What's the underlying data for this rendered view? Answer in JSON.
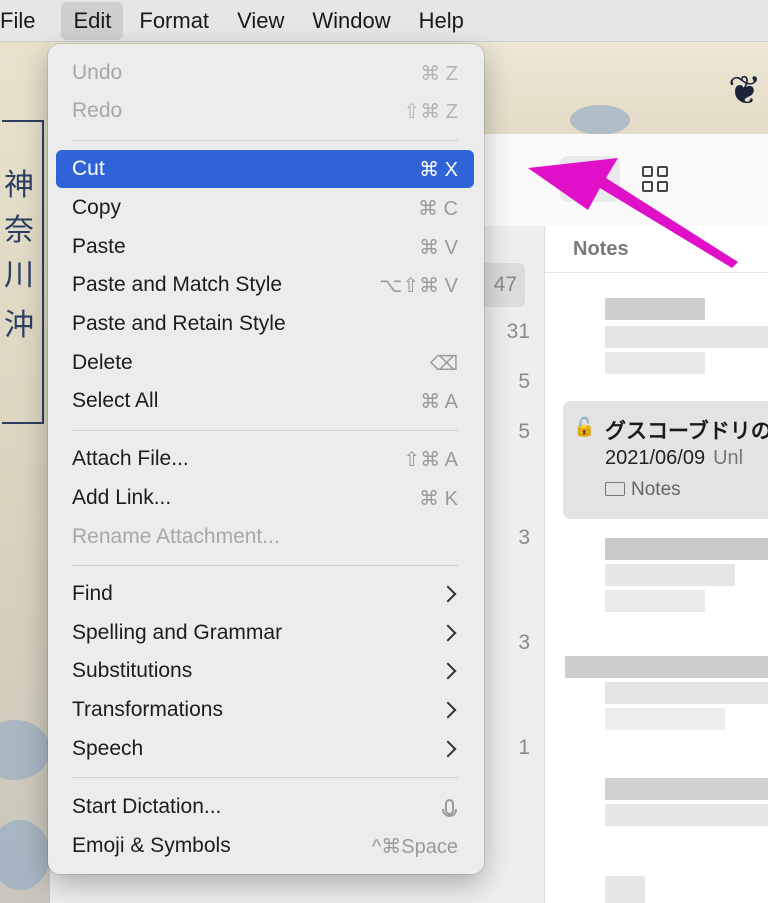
{
  "menubar": {
    "items": [
      {
        "label": "File"
      },
      {
        "label": "Edit"
      },
      {
        "label": "Format"
      },
      {
        "label": "View"
      },
      {
        "label": "Window"
      },
      {
        "label": "Help"
      }
    ]
  },
  "edit_menu": {
    "items": [
      {
        "label": "Undo",
        "shortcut": "⌘ Z"
      },
      {
        "label": "Redo",
        "shortcut": "⇧⌘ Z"
      },
      {
        "label": "Cut",
        "shortcut": "⌘ X"
      },
      {
        "label": "Copy",
        "shortcut": "⌘ C"
      },
      {
        "label": "Paste",
        "shortcut": "⌘ V"
      },
      {
        "label": "Paste and Match Style",
        "shortcut": "⌥⇧⌘ V"
      },
      {
        "label": "Paste and Retain Style",
        "shortcut": ""
      },
      {
        "label": "Delete",
        "shortcut": "⌫"
      },
      {
        "label": "Select All",
        "shortcut": "⌘ A"
      },
      {
        "label": "Attach File...",
        "shortcut": "⇧⌘ A"
      },
      {
        "label": "Add Link...",
        "shortcut": "⌘ K"
      },
      {
        "label": "Rename Attachment...",
        "shortcut": ""
      },
      {
        "label": "Find"
      },
      {
        "label": "Spelling and Grammar"
      },
      {
        "label": "Substitutions"
      },
      {
        "label": "Transformations"
      },
      {
        "label": "Speech"
      },
      {
        "label": "Start Dictation..."
      },
      {
        "label": "Emoji & Symbols",
        "shortcut": "^⌘Space"
      }
    ]
  },
  "sidebar": {
    "counts": [
      "47",
      "31",
      "5",
      "5",
      "3",
      "3",
      "1"
    ]
  },
  "notes_list": {
    "header": "Notes",
    "selected_note": {
      "title": "グスコーブドリの",
      "date": "2021/06/09",
      "preview": "Unl",
      "folder": "Notes"
    }
  },
  "colors": {
    "highlight": "#2f63d8",
    "arrow": "#e010c8"
  }
}
